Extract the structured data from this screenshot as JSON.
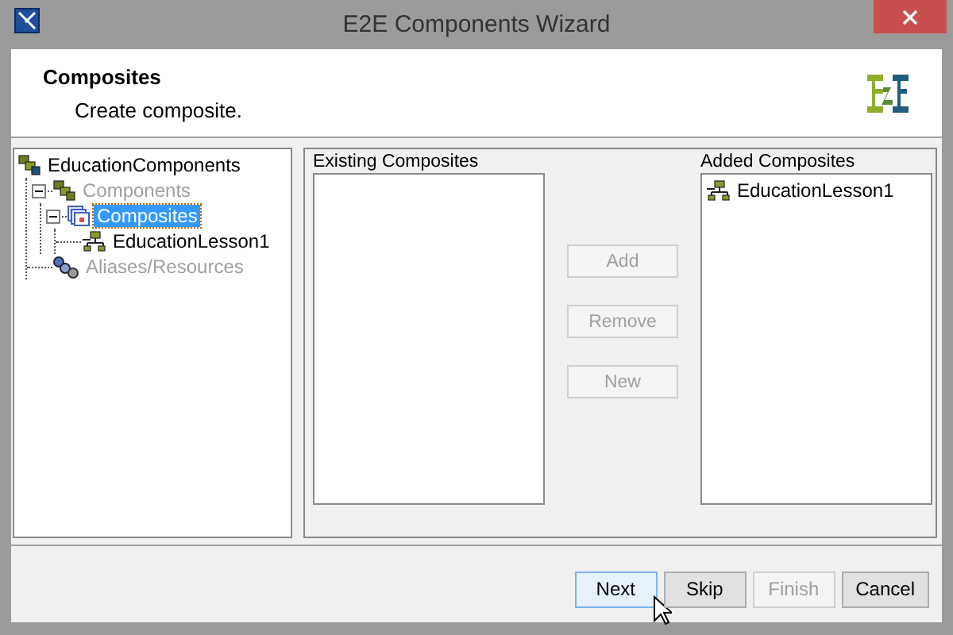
{
  "window": {
    "title": "E2E Components Wizard"
  },
  "header": {
    "title": "Composites",
    "subtitle": "Create composite."
  },
  "tree": [
    {
      "label": "EducationComponents",
      "kind": "package",
      "disabled": false,
      "selected": false,
      "expanded": true,
      "children": [
        {
          "label": "Components",
          "kind": "components",
          "disabled": true,
          "selected": false,
          "expanded": true,
          "children": [
            {
              "label": "Composites",
              "kind": "composites",
              "disabled": false,
              "selected": true,
              "expanded": true,
              "children": [
                {
                  "label": "EducationLesson1",
                  "kind": "lesson",
                  "disabled": false,
                  "selected": false
                }
              ]
            }
          ]
        },
        {
          "label": "Aliases/Resources",
          "kind": "aliases",
          "disabled": true,
          "selected": false
        }
      ]
    }
  ],
  "existing": {
    "label": "Existing Composites"
  },
  "added": {
    "label": "Added Composites",
    "items": [
      {
        "label": "EducationLesson1"
      }
    ]
  },
  "actions": [
    {
      "label": "Add",
      "disabled": true
    },
    {
      "label": "Remove",
      "disabled": true
    },
    {
      "label": "New",
      "disabled": true
    }
  ],
  "footer_buttons": [
    {
      "label": "Next",
      "disabled": false,
      "focused": true
    },
    {
      "label": "Skip",
      "disabled": false,
      "focused": false
    },
    {
      "label": "Finish",
      "disabled": true,
      "focused": false
    },
    {
      "label": "Cancel",
      "disabled": false,
      "focused": false
    }
  ]
}
